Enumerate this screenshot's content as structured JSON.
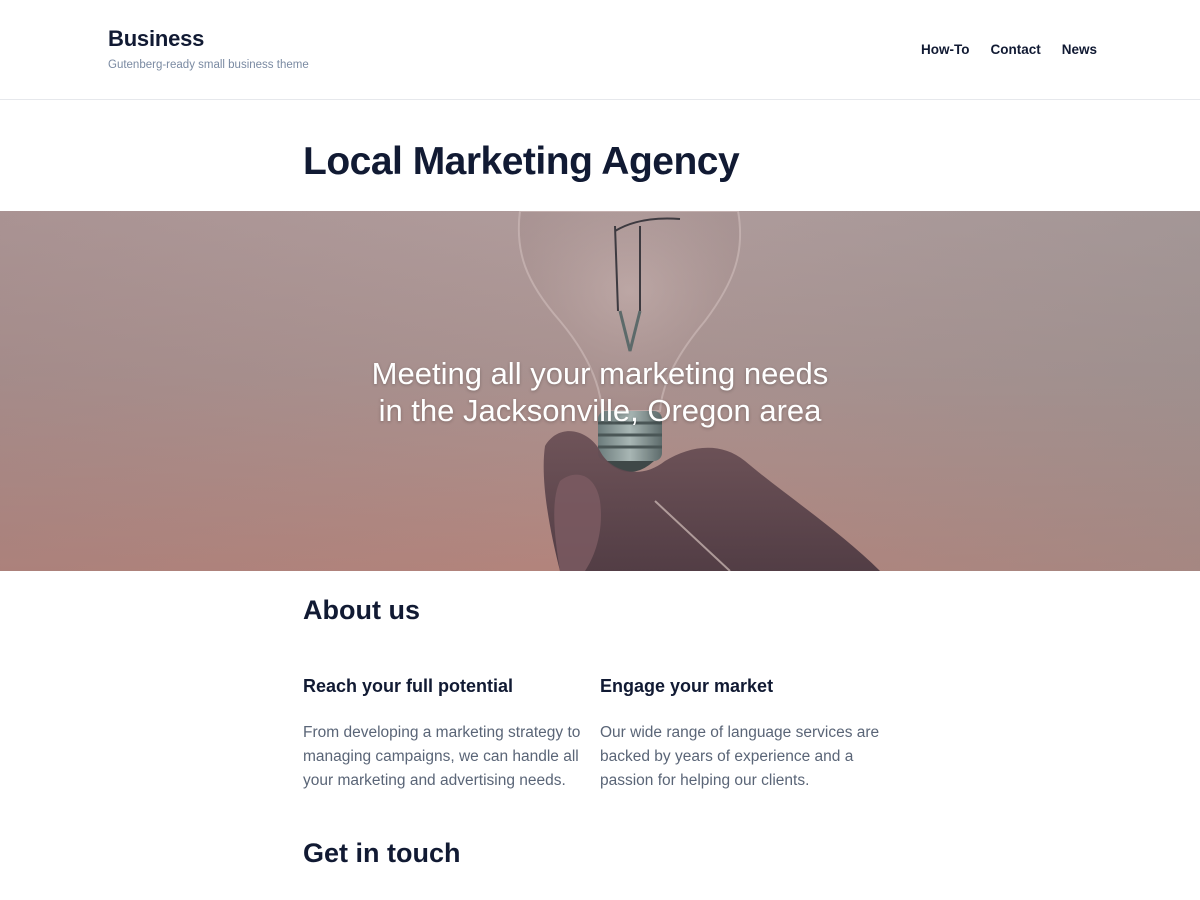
{
  "header": {
    "site_title": "Business",
    "tagline": "Gutenberg-ready small business theme",
    "nav": [
      {
        "label": "How-To"
      },
      {
        "label": "Contact"
      },
      {
        "label": "News"
      }
    ]
  },
  "page": {
    "title": "Local Marketing Agency"
  },
  "hero": {
    "line1": "Meeting all your marketing needs",
    "line2": "in the Jacksonville, Oregon area"
  },
  "about": {
    "heading": "About us",
    "columns": [
      {
        "title": "Reach your full potential",
        "text": "From developing a marketing strategy to managing campaigns, we can handle all your marketing and advertising needs."
      },
      {
        "title": "Engage your market",
        "text": "Our wide range of language services are backed by years of experience and a passion for helping our clients."
      }
    ]
  },
  "contact": {
    "heading": "Get in touch"
  },
  "colors": {
    "text_dark": "#111a33",
    "tagline": "#7a8aa2",
    "body_text": "#5a6577",
    "border": "#e6e8ec"
  }
}
